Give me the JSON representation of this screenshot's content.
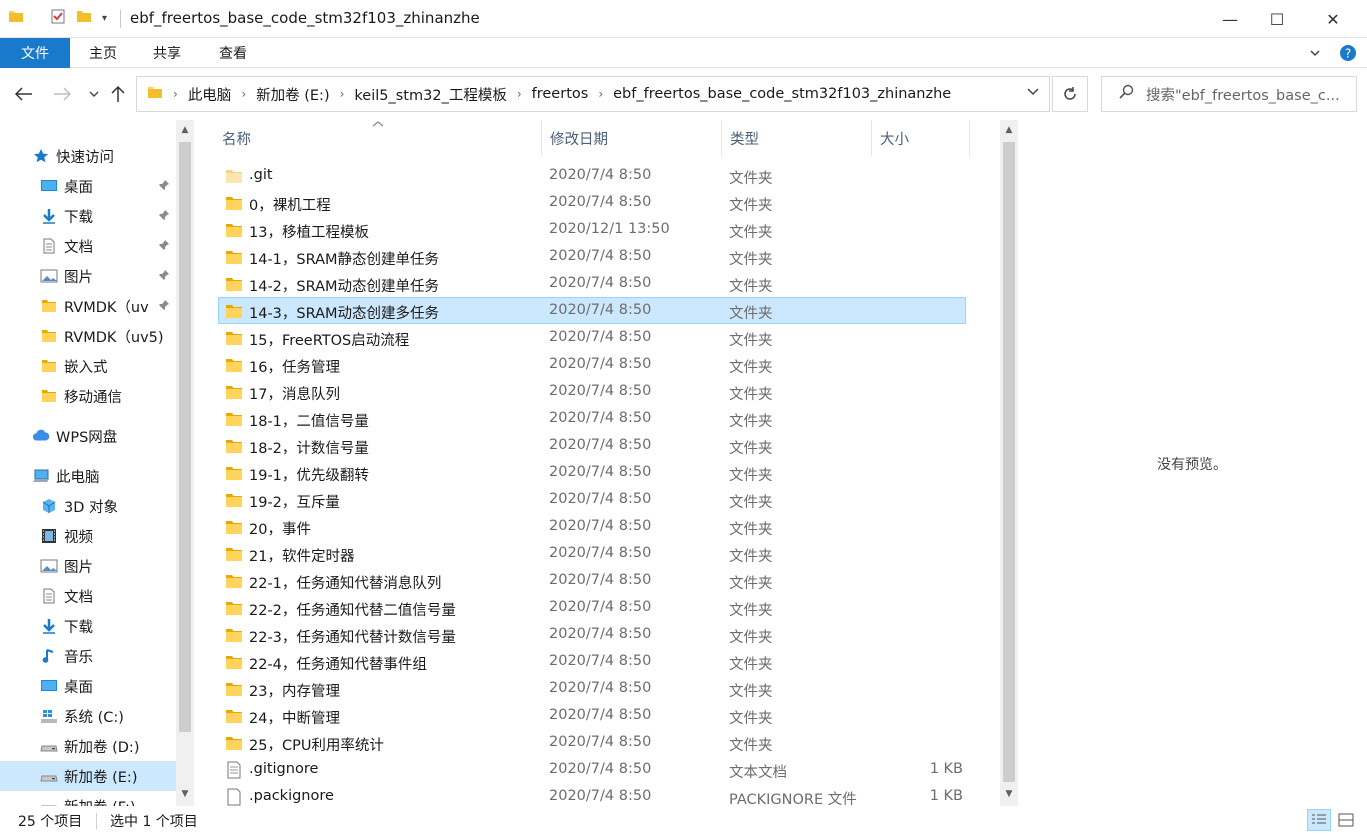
{
  "window": {
    "title": "ebf_freertos_base_code_stm32f103_zhinanzhe",
    "controls": {
      "minimize": "—",
      "maximize": "☐",
      "close": "✕"
    }
  },
  "ribbon": {
    "tabs": [
      "文件",
      "主页",
      "共享",
      "查看"
    ],
    "expand_icon": "chevron-down-icon",
    "help_icon": "help-icon"
  },
  "address": {
    "crumbs": [
      "此电脑",
      "新加卷 (E:)",
      "keil5_stm32_工程模板",
      "freertos",
      "ebf_freertos_base_code_stm32f103_zhinanzhe"
    ],
    "search_placeholder": "搜索\"ebf_freertos_base_c..."
  },
  "sidebar": {
    "items": [
      {
        "label": "快速访问",
        "icon": "star-icon",
        "level": 0,
        "pinned": false
      },
      {
        "label": "桌面",
        "icon": "desktop-icon",
        "level": 1,
        "pinned": true
      },
      {
        "label": "下载",
        "icon": "download-icon",
        "level": 1,
        "pinned": true
      },
      {
        "label": "文档",
        "icon": "document-icon",
        "level": 1,
        "pinned": true
      },
      {
        "label": "图片",
        "icon": "picture-icon",
        "level": 1,
        "pinned": true
      },
      {
        "label": "RVMDK（uv",
        "icon": "folder-icon",
        "level": 1,
        "pinned": true
      },
      {
        "label": "RVMDK（uv5)",
        "icon": "folder-icon",
        "level": 1,
        "pinned": false
      },
      {
        "label": "嵌入式",
        "icon": "folder-icon",
        "level": 1,
        "pinned": false
      },
      {
        "label": "移动通信",
        "icon": "folder-icon",
        "level": 1,
        "pinned": false
      },
      {
        "label": "WPS网盘",
        "icon": "cloud-icon",
        "level": 0,
        "pinned": false
      },
      {
        "label": "此电脑",
        "icon": "computer-icon",
        "level": 0,
        "pinned": false
      },
      {
        "label": "3D 对象",
        "icon": "cube-icon",
        "level": 1,
        "pinned": false
      },
      {
        "label": "视频",
        "icon": "video-icon",
        "level": 1,
        "pinned": false
      },
      {
        "label": "图片",
        "icon": "picture-icon",
        "level": 1,
        "pinned": false
      },
      {
        "label": "文档",
        "icon": "document-icon",
        "level": 1,
        "pinned": false
      },
      {
        "label": "下载",
        "icon": "download-icon",
        "level": 1,
        "pinned": false
      },
      {
        "label": "音乐",
        "icon": "music-icon",
        "level": 1,
        "pinned": false
      },
      {
        "label": "桌面",
        "icon": "desktop-icon",
        "level": 1,
        "pinned": false
      },
      {
        "label": "系统 (C:)",
        "icon": "windows-drive-icon",
        "level": 1,
        "pinned": false
      },
      {
        "label": "新加卷 (D:)",
        "icon": "drive-icon",
        "level": 1,
        "pinned": false
      },
      {
        "label": "新加卷 (E:)",
        "icon": "drive-icon",
        "level": 1,
        "pinned": false,
        "selected": true
      },
      {
        "label": "新加卷 (F:)",
        "icon": "drive-icon",
        "level": 1,
        "pinned": false
      }
    ]
  },
  "columns": {
    "name": "名称",
    "date": "修改日期",
    "type": "类型",
    "size": "大小"
  },
  "files": [
    {
      "name": ".git",
      "date": "2020/7/4 8:50",
      "type": "文件夹",
      "size": "",
      "kind": "folder-light"
    },
    {
      "name": "0，裸机工程",
      "date": "2020/7/4 8:50",
      "type": "文件夹",
      "size": "",
      "kind": "folder"
    },
    {
      "name": "13，移植工程模板",
      "date": "2020/12/1 13:50",
      "type": "文件夹",
      "size": "",
      "kind": "folder"
    },
    {
      "name": "14-1，SRAM静态创建单任务",
      "date": "2020/7/4 8:50",
      "type": "文件夹",
      "size": "",
      "kind": "folder"
    },
    {
      "name": "14-2，SRAM动态创建单任务",
      "date": "2020/7/4 8:50",
      "type": "文件夹",
      "size": "",
      "kind": "folder"
    },
    {
      "name": "14-3，SRAM动态创建多任务",
      "date": "2020/7/4 8:50",
      "type": "文件夹",
      "size": "",
      "kind": "folder",
      "selected": true
    },
    {
      "name": "15，FreeRTOS启动流程",
      "date": "2020/7/4 8:50",
      "type": "文件夹",
      "size": "",
      "kind": "folder"
    },
    {
      "name": "16，任务管理",
      "date": "2020/7/4 8:50",
      "type": "文件夹",
      "size": "",
      "kind": "folder"
    },
    {
      "name": "17，消息队列",
      "date": "2020/7/4 8:50",
      "type": "文件夹",
      "size": "",
      "kind": "folder"
    },
    {
      "name": "18-1，二值信号量",
      "date": "2020/7/4 8:50",
      "type": "文件夹",
      "size": "",
      "kind": "folder"
    },
    {
      "name": "18-2，计数信号量",
      "date": "2020/7/4 8:50",
      "type": "文件夹",
      "size": "",
      "kind": "folder"
    },
    {
      "name": "19-1，优先级翻转",
      "date": "2020/7/4 8:50",
      "type": "文件夹",
      "size": "",
      "kind": "folder"
    },
    {
      "name": "19-2，互斥量",
      "date": "2020/7/4 8:50",
      "type": "文件夹",
      "size": "",
      "kind": "folder"
    },
    {
      "name": "20，事件",
      "date": "2020/7/4 8:50",
      "type": "文件夹",
      "size": "",
      "kind": "folder"
    },
    {
      "name": "21，软件定时器",
      "date": "2020/7/4 8:50",
      "type": "文件夹",
      "size": "",
      "kind": "folder"
    },
    {
      "name": "22-1，任务通知代替消息队列",
      "date": "2020/7/4 8:50",
      "type": "文件夹",
      "size": "",
      "kind": "folder"
    },
    {
      "name": "22-2，任务通知代替二值信号量",
      "date": "2020/7/4 8:50",
      "type": "文件夹",
      "size": "",
      "kind": "folder"
    },
    {
      "name": "22-3，任务通知代替计数信号量",
      "date": "2020/7/4 8:50",
      "type": "文件夹",
      "size": "",
      "kind": "folder"
    },
    {
      "name": "22-4，任务通知代替事件组",
      "date": "2020/7/4 8:50",
      "type": "文件夹",
      "size": "",
      "kind": "folder"
    },
    {
      "name": "23，内存管理",
      "date": "2020/7/4 8:50",
      "type": "文件夹",
      "size": "",
      "kind": "folder"
    },
    {
      "name": "24，中断管理",
      "date": "2020/7/4 8:50",
      "type": "文件夹",
      "size": "",
      "kind": "folder"
    },
    {
      "name": "25，CPU利用率统计",
      "date": "2020/7/4 8:50",
      "type": "文件夹",
      "size": "",
      "kind": "folder"
    },
    {
      "name": ".gitignore",
      "date": "2020/7/4 8:50",
      "type": "文本文档",
      "size": "1 KB",
      "kind": "text"
    },
    {
      "name": ".packignore",
      "date": "2020/7/4 8:50",
      "type": "PACKIGNORE 文件",
      "size": "1 KB",
      "kind": "file"
    }
  ],
  "preview": {
    "message": "没有预览。"
  },
  "status": {
    "count": "25 个项目",
    "selected": "选中 1 个项目"
  },
  "colors": {
    "accent": "#1979ca",
    "selection": "#cce8ff",
    "selection_border": "#99d1ff",
    "folder": "#ffd35c"
  }
}
